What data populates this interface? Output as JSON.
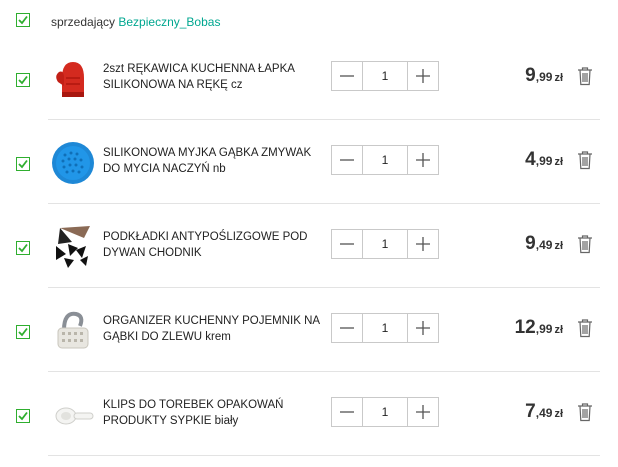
{
  "seller": {
    "prefix": "sprzedający",
    "name": "Bezpieczny_Bobas"
  },
  "colors": {
    "checkbox_green": "#2fae2f",
    "seller_link": "#00a790",
    "price_text": "#333333"
  },
  "items": [
    {
      "title": "2szt RĘKAWICA KUCHENNA ŁAPKA SILIKONOWA NA RĘKĘ cz",
      "thumbnail": "red-oven-mitt",
      "quantity": "1",
      "price_main": "9",
      "price_fraction": ",99",
      "currency": "zł"
    },
    {
      "title": "SILIKONOWA MYJKA GĄBKA ZMYWAK DO MYCIA NACZYŃ nb",
      "thumbnail": "blue-silicone-sponge",
      "quantity": "1",
      "price_main": "4",
      "price_fraction": ",99",
      "currency": "zł"
    },
    {
      "title": "PODKŁADKI ANTYPOŚLIZGOWE POD DYWAN CHODNIK",
      "thumbnail": "black-triangle-pads",
      "quantity": "1",
      "price_main": "9",
      "price_fraction": ",49",
      "currency": "zł"
    },
    {
      "title": "ORGANIZER KUCHENNY POJEMNIK NA GĄBKI DO ZLEWU krem",
      "thumbnail": "sink-caddy",
      "quantity": "1",
      "price_main": "12",
      "price_fraction": ",99",
      "currency": "zł"
    },
    {
      "title": "KLIPS DO TOREBEK OPAKOWAŃ PRODUKTY SYPKIE biały",
      "thumbnail": "bag-clip",
      "quantity": "1",
      "price_main": "7",
      "price_fraction": ",49",
      "currency": "zł"
    }
  ]
}
